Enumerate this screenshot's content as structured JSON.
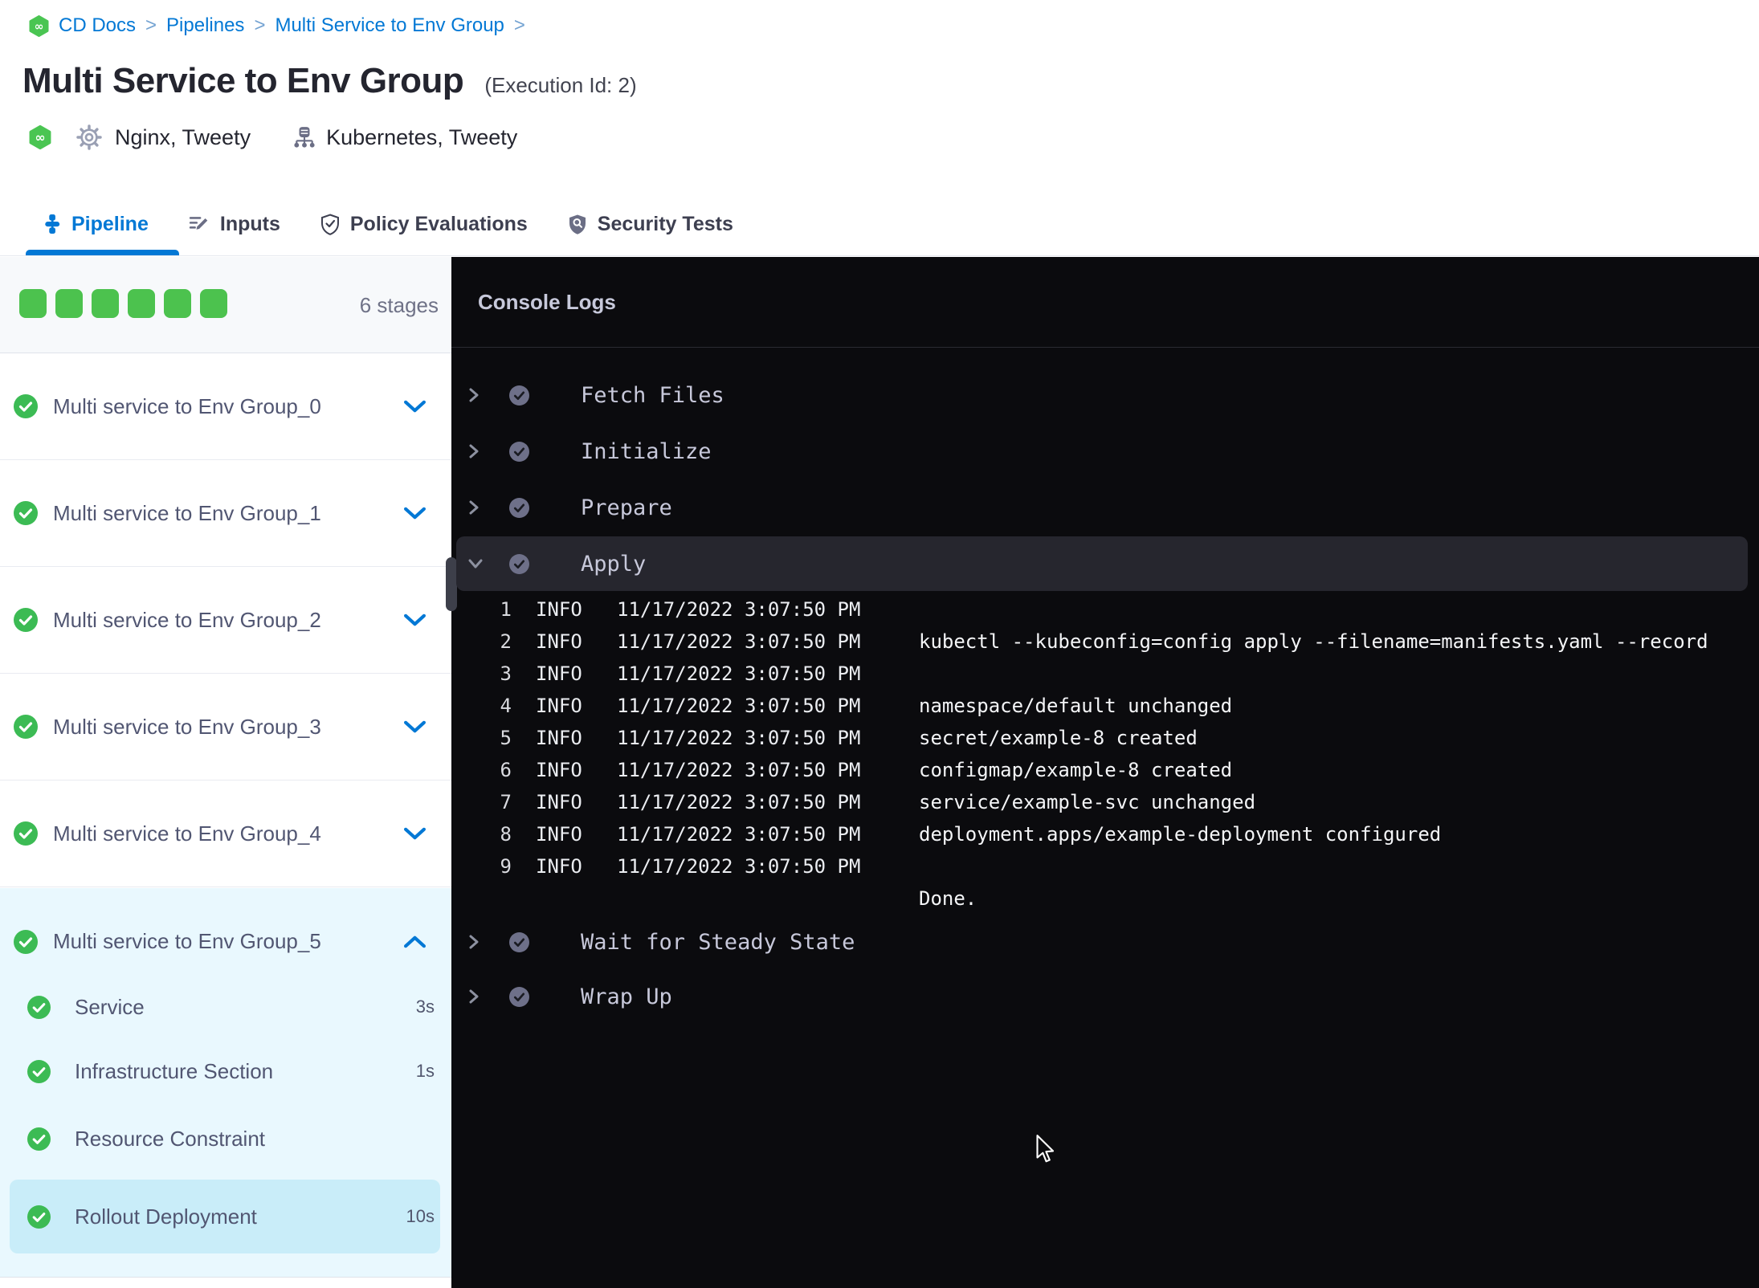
{
  "breadcrumb": {
    "items": [
      "CD Docs",
      "Pipelines",
      "Multi Service to Env Group"
    ],
    "separator": ">"
  },
  "header": {
    "title": "Multi Service to Env Group",
    "execution_id": "(Execution Id: 2)",
    "services": "Nginx, Tweety",
    "environments": "Kubernetes, Tweety"
  },
  "tabs": [
    {
      "label": "Pipeline",
      "active": true
    },
    {
      "label": "Inputs",
      "active": false
    },
    {
      "label": "Policy Evaluations",
      "active": false
    },
    {
      "label": "Security Tests",
      "active": false
    }
  ],
  "sidebar": {
    "stage_count": "6 stages",
    "stage_squares": 6,
    "stages": [
      {
        "name": "Multi service to Env Group_0"
      },
      {
        "name": "Multi service to Env Group_1"
      },
      {
        "name": "Multi service to Env Group_2"
      },
      {
        "name": "Multi service to Env Group_3"
      },
      {
        "name": "Multi service to Env Group_4"
      }
    ],
    "expanded_stage": {
      "name": "Multi service to Env Group_5",
      "steps": [
        {
          "name": "Service",
          "duration": "3s",
          "selected": false
        },
        {
          "name": "Infrastructure Section",
          "duration": "1s",
          "selected": false
        },
        {
          "name": "Resource Constraint",
          "duration": "",
          "selected": false
        },
        {
          "name": "Rollout Deployment",
          "duration": "10s",
          "selected": true
        }
      ]
    }
  },
  "console": {
    "title": "Console Logs",
    "steps": [
      {
        "name": "Fetch Files",
        "state": "collapsed"
      },
      {
        "name": "Initialize",
        "state": "collapsed"
      },
      {
        "name": "Prepare",
        "state": "collapsed"
      },
      {
        "name": "Apply",
        "state": "expanded"
      },
      {
        "name": "Wait for Steady State",
        "state": "collapsed"
      },
      {
        "name": "Wrap Up",
        "state": "collapsed"
      }
    ],
    "logs": [
      {
        "n": "1",
        "level": "INFO",
        "time": "11/17/2022 3:07:50 PM",
        "message": ""
      },
      {
        "n": "2",
        "level": "INFO",
        "time": "11/17/2022 3:07:50 PM",
        "message": "kubectl --kubeconfig=config apply --filename=manifests.yaml --record"
      },
      {
        "n": "3",
        "level": "INFO",
        "time": "11/17/2022 3:07:50 PM",
        "message": ""
      },
      {
        "n": "4",
        "level": "INFO",
        "time": "11/17/2022 3:07:50 PM",
        "message": "namespace/default unchanged"
      },
      {
        "n": "5",
        "level": "INFO",
        "time": "11/17/2022 3:07:50 PM",
        "message": "secret/example-8 created"
      },
      {
        "n": "6",
        "level": "INFO",
        "time": "11/17/2022 3:07:50 PM",
        "message": "configmap/example-8 created"
      },
      {
        "n": "7",
        "level": "INFO",
        "time": "11/17/2022 3:07:50 PM",
        "message": "service/example-svc unchanged"
      },
      {
        "n": "8",
        "level": "INFO",
        "time": "11/17/2022 3:07:50 PM",
        "message": "deployment.apps/example-deployment configured"
      },
      {
        "n": "9",
        "level": "INFO",
        "time": "11/17/2022 3:07:50 PM",
        "message": ""
      }
    ],
    "trailing_message": "Done."
  },
  "colors": {
    "accent_blue": "#0278d5",
    "success_green": "#3cbb54",
    "square_green": "#4cc24e",
    "console_bg": "#0b0b0e",
    "apply_row_bg": "#26262e",
    "expanded_stage_bg": "#e9f8fe",
    "selected_step_bg": "#c9edf9"
  }
}
